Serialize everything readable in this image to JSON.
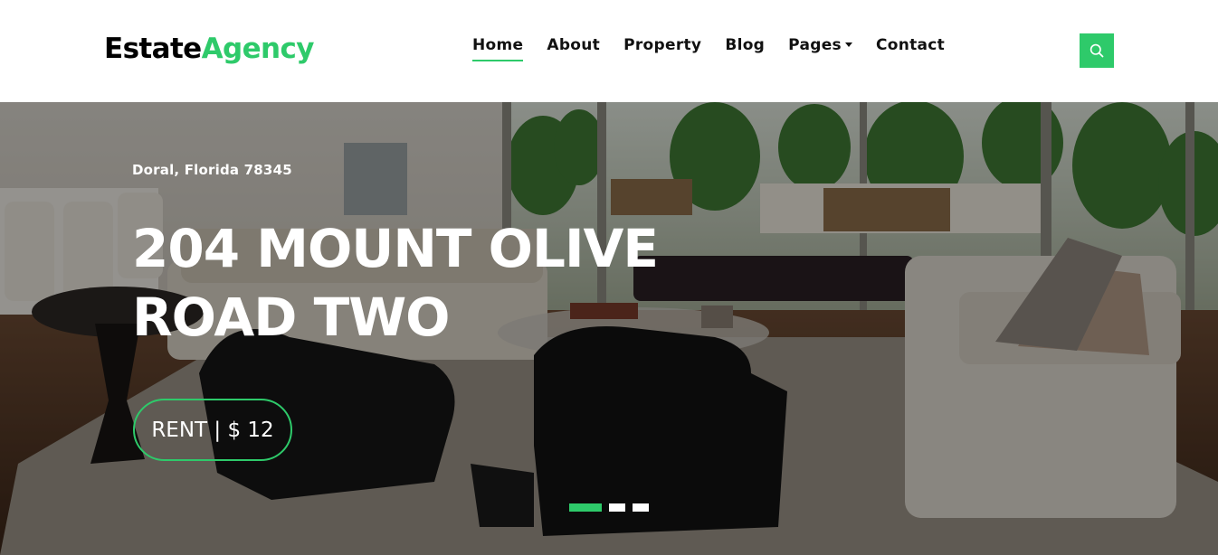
{
  "brand": {
    "part1": "Estate",
    "part2": "Agency"
  },
  "nav": {
    "items": [
      {
        "label": "Home",
        "active": true
      },
      {
        "label": "About"
      },
      {
        "label": "Property"
      },
      {
        "label": "Blog"
      },
      {
        "label": "Pages",
        "dropdown": true
      },
      {
        "label": "Contact"
      }
    ]
  },
  "search": {
    "icon": "search-icon"
  },
  "hero": {
    "location": "Doral, Florida 78345",
    "title_line1": "204 MOUNT OLIVE",
    "title_line2": "ROAD TWO",
    "price": "RENT | $ 12",
    "slides": {
      "count": 3,
      "active": 1
    }
  },
  "colors": {
    "accent": "#2eca6a",
    "text": "#000000"
  }
}
